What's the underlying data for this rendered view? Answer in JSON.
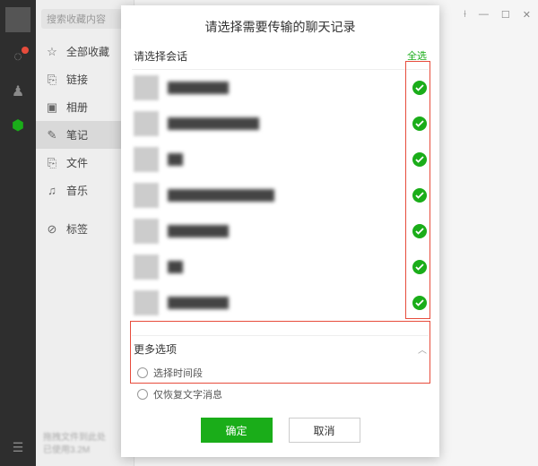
{
  "rail": {
    "icons": [
      "chat",
      "contacts",
      "favorites"
    ]
  },
  "sidebar": {
    "search_placeholder": "搜索收藏内容",
    "items": [
      {
        "label": "全部收藏",
        "icon": "star"
      },
      {
        "label": "链接",
        "icon": "link"
      },
      {
        "label": "相册",
        "icon": "image"
      },
      {
        "label": "笔记",
        "icon": "note",
        "active": true
      },
      {
        "label": "文件",
        "icon": "file"
      },
      {
        "label": "音乐",
        "icon": "music"
      },
      {
        "label": "标签",
        "icon": "tag"
      }
    ],
    "storage_line1": "拖拽文件到此处",
    "storage_line2": "已使用3.2M"
  },
  "bg_controls": {
    "pin": "⟊",
    "min": "—",
    "max": "☐",
    "close": "✕"
  },
  "modal": {
    "title": "请选择需要传输的聊天记录",
    "select_label": "请选择会话",
    "select_all": "全选",
    "chats": [
      {
        "name": "████████",
        "checked": true
      },
      {
        "name": "████████████",
        "checked": true
      },
      {
        "name": "██",
        "checked": true
      },
      {
        "name": "██████████████",
        "checked": true
      },
      {
        "name": "████████",
        "checked": true
      },
      {
        "name": "██",
        "checked": true
      },
      {
        "name": "████████",
        "checked": true
      }
    ],
    "more_label": "更多选项",
    "option_timerange": "选择时间段",
    "option_textonly": "仅恢复文字消息",
    "confirm": "确定",
    "cancel": "取消"
  }
}
